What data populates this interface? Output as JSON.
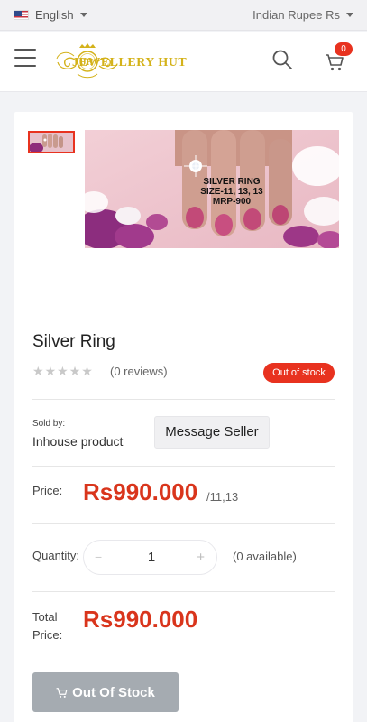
{
  "topbar": {
    "language": "English",
    "currency": "Indian Rupee Rs"
  },
  "header": {
    "logo_text": "JEWELLERY HUT",
    "logo_monogram": "JH",
    "cart_count": "0"
  },
  "gallery": {
    "image_caption_lines": [
      "SILVER RING",
      "SIZE-11, 13, 13",
      "MRP-900"
    ]
  },
  "product": {
    "title": "Silver Ring",
    "rating_stars": 0,
    "reviews": "(0 reviews)",
    "stock_badge": "Out of stock",
    "sold_by_label": "Sold by:",
    "seller": "Inhouse product",
    "message_seller": "Message Seller",
    "price_label": "Price:",
    "price": "Rs990.000",
    "price_unit": "/11,13",
    "quantity_label": "Quantity:",
    "quantity_minus": "−",
    "quantity_value": "1",
    "quantity_plus": "+",
    "available": "(0 available)",
    "total_label_line1": "Total",
    "total_label_line2": "Price:",
    "total_price": "Rs990.000",
    "out_of_stock_button": "Out Of Stock"
  },
  "colors": {
    "accent": "#e8321f",
    "price": "#d9351c",
    "logo_gold": "#d4b21a",
    "disabled_button": "#a5abb1"
  }
}
